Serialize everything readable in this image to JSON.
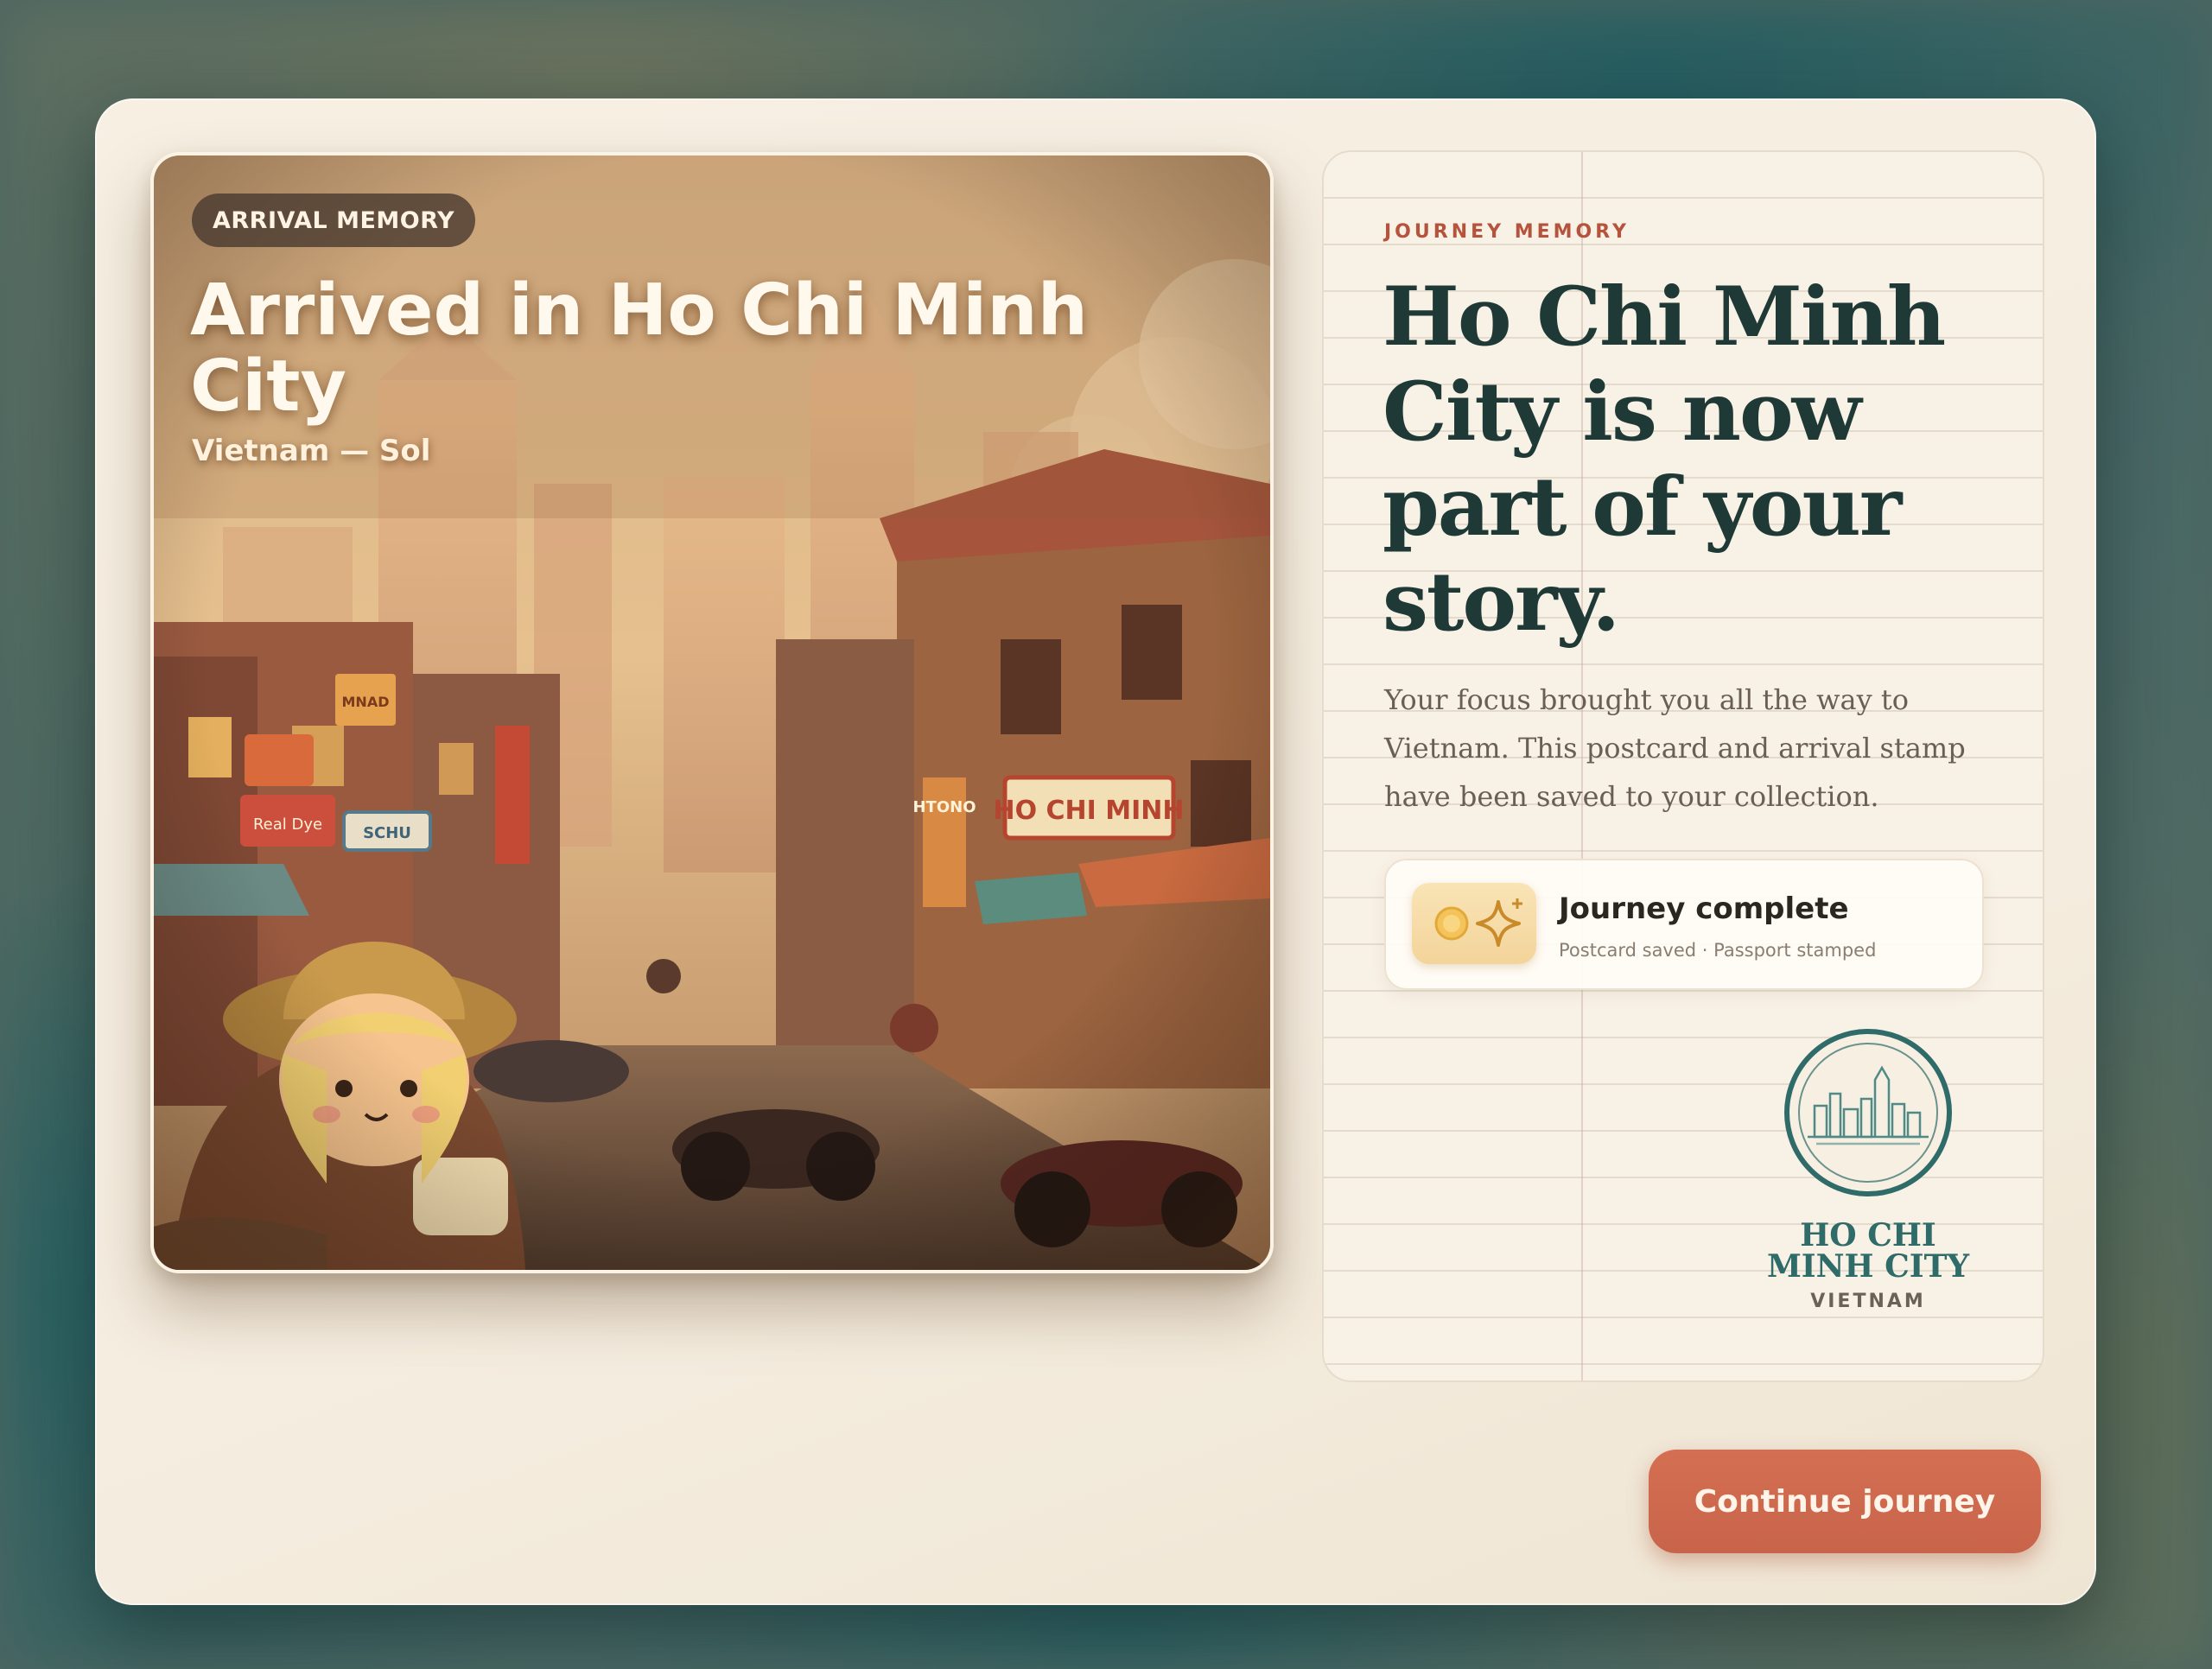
{
  "postcard": {
    "badge": "ARRIVAL MEMORY",
    "title": "Arrived in Ho Chi Minh City",
    "subtitle": "Vietnam — Sol",
    "scene_signs": [
      "HO CHI MINH",
      "HTONO",
      "MNAD",
      "Real Dye",
      "SCHU"
    ]
  },
  "journal": {
    "eyebrow": "JOURNEY MEMORY",
    "headline": "Ho Chi Minh City is now part of your story.",
    "body": "Your focus brought you all the way to Vietnam. This postcard and arrival stamp have been saved to your collection.",
    "status": {
      "title": "Journey complete",
      "subtitle": "Postcard saved · Passport stamped",
      "icons": [
        "coin-icon",
        "sparkle-icon"
      ]
    },
    "stamp": {
      "city": "HO CHI MINH CITY",
      "country": "VIETNAM"
    }
  },
  "actions": {
    "continue_label": "Continue journey"
  },
  "colors": {
    "accent": "#c96a4e",
    "heading": "#1f3a36",
    "stamp": "#2f6b68",
    "eyebrow": "#b5533c"
  }
}
